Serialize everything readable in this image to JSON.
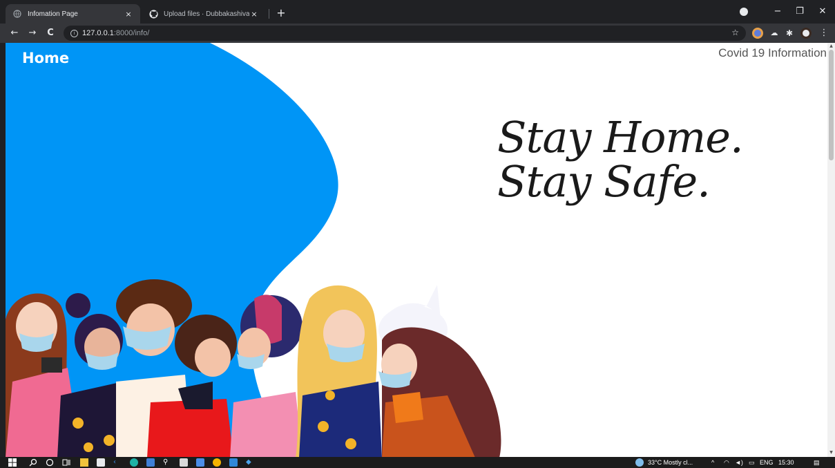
{
  "browser": {
    "tabs": [
      {
        "title": "Infomation Page",
        "active": true,
        "close": "×"
      },
      {
        "title": "Upload files · Dubbakashivaredd",
        "active": false,
        "close": "×"
      }
    ],
    "new_tab": "+",
    "window_controls": {
      "minimize": "−",
      "maximize": "❐",
      "close": "✕"
    },
    "nav": {
      "back": "←",
      "forward": "→",
      "reload": "C"
    },
    "url": {
      "host": "127.0.0.1",
      "path": ":8000/info/"
    },
    "star": "☆",
    "menu": "⋮"
  },
  "page": {
    "home_link": "Home",
    "header_title": "Covid 19 Information",
    "slogan_line1": "Stay Home.",
    "slogan_line2": "Stay Safe.",
    "accent_color": "#0095f6"
  },
  "taskbar": {
    "weather": "33°C  Mostly cl...",
    "language": "ENG",
    "time": "15:30"
  }
}
